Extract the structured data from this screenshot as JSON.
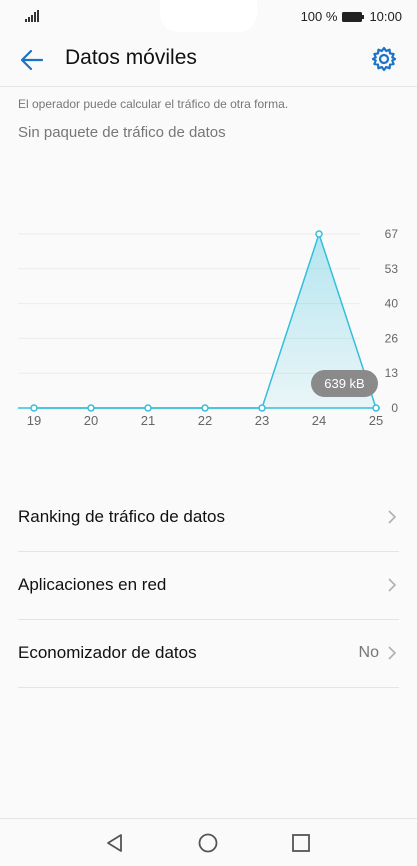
{
  "status_bar": {
    "battery_percent": "100 %",
    "time": "10:00",
    "icons": [
      "signal-icon",
      "battery-icon"
    ]
  },
  "header": {
    "title": "Datos móviles",
    "back_icon": "arrow-left-icon",
    "settings_icon": "gear-icon"
  },
  "info": {
    "operator_note": "El operador puede calcular el tráfico de otra forma.",
    "package_status": "Sin paquete de tráfico de datos"
  },
  "chart_data": {
    "type": "area",
    "x": [
      "19",
      "20",
      "21",
      "22",
      "23",
      "24",
      "25"
    ],
    "y_ticks": [
      "67",
      "53",
      "40",
      "26",
      "13",
      "0"
    ],
    "values": [
      0,
      0,
      0,
      0,
      0,
      67,
      0
    ],
    "ylim": [
      0,
      67
    ],
    "tooltip": "639 kB",
    "colors": {
      "line": "#33bfdc",
      "fill": "#cdeef8"
    },
    "grid": true
  },
  "menu": {
    "items": [
      {
        "label": "Ranking de tráfico de datos",
        "value": ""
      },
      {
        "label": "Aplicaciones en red",
        "value": ""
      },
      {
        "label": "Economizador de datos",
        "value": "No"
      }
    ]
  },
  "nav": {
    "icons": [
      "back-triangle-icon",
      "home-circle-icon",
      "recents-square-icon"
    ]
  },
  "colors": {
    "accent": "#1a73c6"
  }
}
